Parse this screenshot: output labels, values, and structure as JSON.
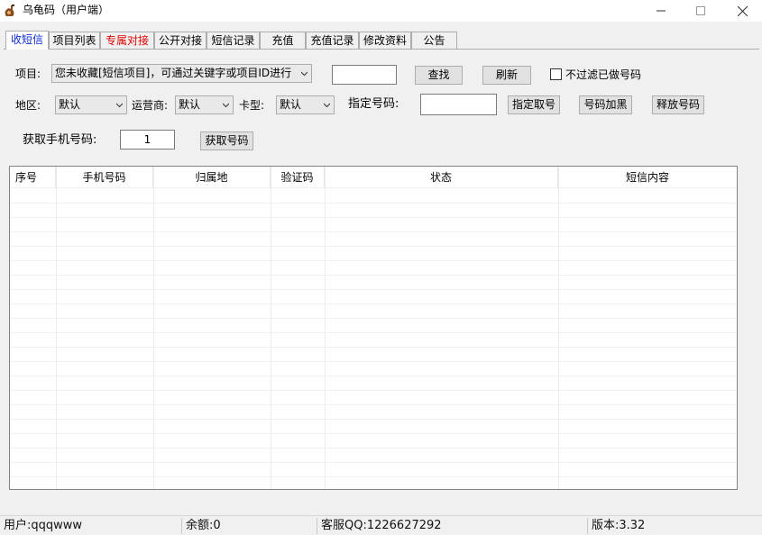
{
  "window": {
    "title": "乌龟码（用户端）",
    "icon": "turtle-icon",
    "controls": {
      "minimize": "—",
      "maximize": "☐",
      "close": "✕"
    }
  },
  "tabs": [
    {
      "label": "收短信",
      "active": true
    },
    {
      "label": "项目列表"
    },
    {
      "label": "专属对接",
      "highlight": "#e00000"
    },
    {
      "label": "公开对接"
    },
    {
      "label": "短信记录"
    },
    {
      "label": "充值"
    },
    {
      "label": "充值记录"
    },
    {
      "label": "修改资料"
    },
    {
      "label": "公告"
    }
  ],
  "form": {
    "project_label": "项目:",
    "project_value": "您未收藏[短信项目]，可通过关键字或项目ID进行",
    "search_value": "",
    "search_button": "查找",
    "refresh_button": "刷新",
    "filter_label": "不过滤已做号码",
    "filter_checked": false,
    "region_label": "地区:",
    "region_value": "默认",
    "carrier_label": "运营商:",
    "carrier_value": "默认",
    "cardtype_label": "卡型:",
    "cardtype_value": "默认",
    "specify_label": "指定号码:",
    "specify_value": "",
    "specify_button": "指定取号",
    "blacklist_button": "号码加黑",
    "release_button": "释放号码",
    "count_label": "获取手机号码:",
    "count_value": "1",
    "get_button": "获取号码"
  },
  "table": {
    "columns": [
      "序号",
      "手机号码",
      "归属地",
      "验证码",
      "状态",
      "短信内容"
    ],
    "rows": []
  },
  "status": {
    "user": "用户:qqqwww",
    "balance": "余额:0",
    "support": "客服QQ:1226627292",
    "version": "版本:3.32"
  }
}
